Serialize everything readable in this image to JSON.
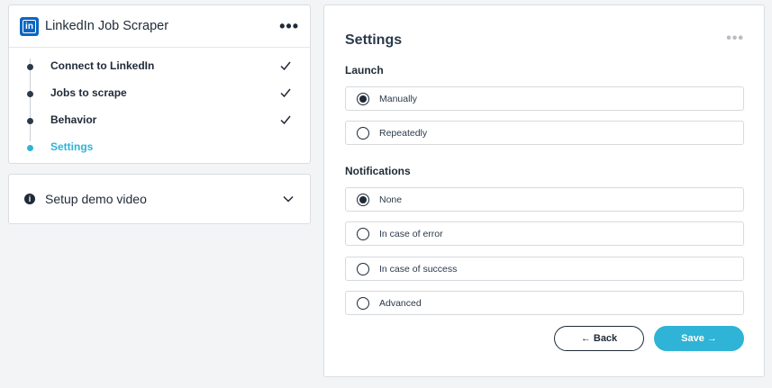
{
  "app": {
    "title": "LinkedIn Job Scraper",
    "logo_text": "in",
    "more_icon": "more-horizontal-icon"
  },
  "steps": [
    {
      "label": "Connect to LinkedIn",
      "done": true,
      "active": false
    },
    {
      "label": "Jobs to scrape",
      "done": true,
      "active": false
    },
    {
      "label": "Behavior",
      "done": true,
      "active": false
    },
    {
      "label": "Settings",
      "done": false,
      "active": true
    }
  ],
  "demo": {
    "label": "Setup demo video",
    "info_glyph": "i",
    "icon": "chevron-down-icon"
  },
  "settings": {
    "title": "Settings",
    "more_glyph": "•••",
    "launch": {
      "label": "Launch",
      "options": [
        {
          "label": "Manually",
          "selected": true
        },
        {
          "label": "Repeatedly",
          "selected": false
        }
      ]
    },
    "notifications": {
      "label": "Notifications",
      "options": [
        {
          "label": "None",
          "selected": true
        },
        {
          "label": "In case of error",
          "selected": false
        },
        {
          "label": "In case of success",
          "selected": false
        },
        {
          "label": "Advanced",
          "selected": false
        }
      ]
    },
    "back_label": "← Back",
    "save_label": "Save →"
  },
  "colors": {
    "accent": "#2fb3d6",
    "linkedin": "#0a66c2",
    "text": "#1f2a37"
  },
  "header_dots": "•••"
}
